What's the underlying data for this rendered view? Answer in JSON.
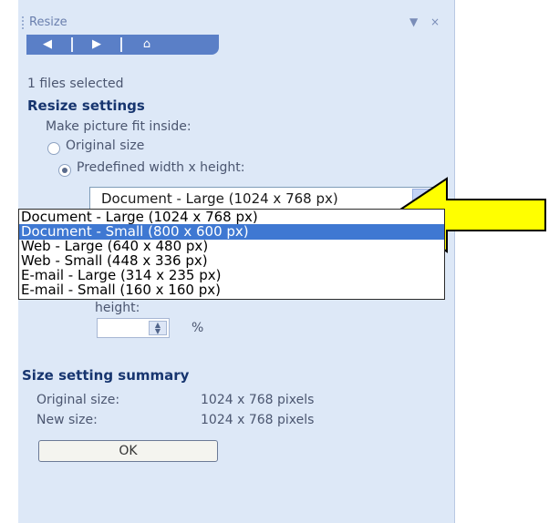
{
  "pane": {
    "title": "Resize",
    "dropdown_icon": "▼",
    "close_icon": "×",
    "toolbar": [
      {
        "name": "back-icon",
        "glyph": "◀"
      },
      {
        "name": "forward-icon",
        "glyph": "▶"
      },
      {
        "name": "home-icon",
        "glyph": "⌂"
      }
    ]
  },
  "status": {
    "files_selected": "1 files selected"
  },
  "resize_settings": {
    "heading": "Resize settings",
    "fit_label": "Make picture fit inside:",
    "original_label": "Original size",
    "predefined_label": "Predefined width x height:",
    "original_checked": false,
    "predefined_checked": true,
    "combo_value": "Document - Large (1024 x 768 px)",
    "combo_arrow": "▼"
  },
  "dropdown_options": [
    "Document - Large (1024 x 768 px)",
    "Document - Small (800 x 600 px)",
    "Web - Large (640 x 480 px)",
    "Web - Small (448 x 336 px)",
    "E-mail - Large (314 x 235 px)",
    "E-mail - Small (160 x 160 px)"
  ],
  "dropdown_selected_index": 1,
  "height": {
    "label": "height:",
    "value": "",
    "unit": "%"
  },
  "summary": {
    "heading": "Size setting summary",
    "original_label": "Original size:",
    "original_value": "1024 x 768 pixels",
    "new_label": "New size:",
    "new_value": "1024 x 768 pixels"
  },
  "ok_label": "OK",
  "colors": {
    "pane_bg": "#dde8f7",
    "toolbar": "#5a7fc7",
    "heading": "#17356f",
    "selection": "#3f78d2",
    "arrow": "#ffff00"
  }
}
